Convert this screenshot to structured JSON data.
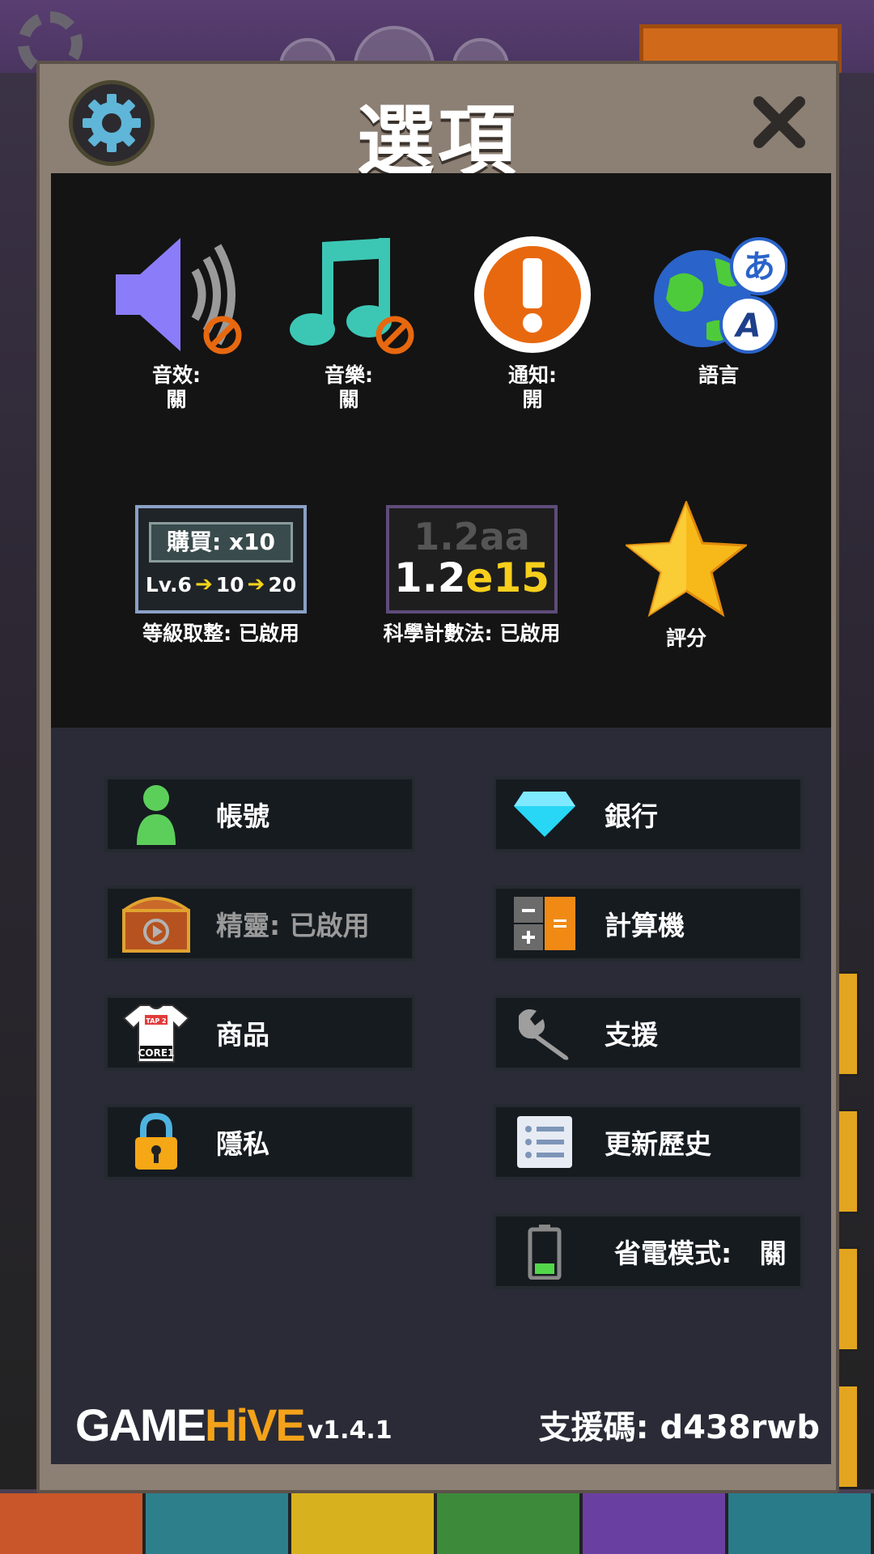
{
  "dialog": {
    "title": "選項",
    "close_icon": "close-icon"
  },
  "options": {
    "sound": {
      "name": "音效:",
      "state": "關"
    },
    "music": {
      "name": "音樂:",
      "state": "關"
    },
    "notify": {
      "name": "通知:",
      "state": "開"
    },
    "language": {
      "name": "語言"
    },
    "rounding": {
      "label": "等級取整: 已啟用",
      "buy": "購買: x10",
      "lv": "Lv.6",
      "lv_a": "10",
      "lv_b": "20"
    },
    "scientific": {
      "label": "科學計數法: 已啟用",
      "old": "1.2aa",
      "new_base": "1.2",
      "new_exp": "e15"
    },
    "rate": {
      "label": "評分"
    }
  },
  "menu": {
    "account": "帳號",
    "bank": "銀行",
    "fairy": "精靈: 已啟用",
    "calculator": "計算機",
    "merch": "商品",
    "support": "支援",
    "privacy": "隱私",
    "changelog": "更新歷史",
    "power_saving": "省電模式:   關",
    "merch_shirt_text_top": "TAP 2",
    "merch_shirt_text_bottom": "CORE1"
  },
  "footer": {
    "logo_a": "GAME",
    "logo_b": "HiVE",
    "version": "v1.4.1",
    "support_code": "支援碼: d438rwb"
  },
  "colors": {
    "accent_orange": "#e8680f",
    "sound_purple": "#8b7dfa",
    "music_teal": "#3cc7b5",
    "star_gold": "#f7b91a",
    "diamond_cyan": "#27d7f5"
  }
}
